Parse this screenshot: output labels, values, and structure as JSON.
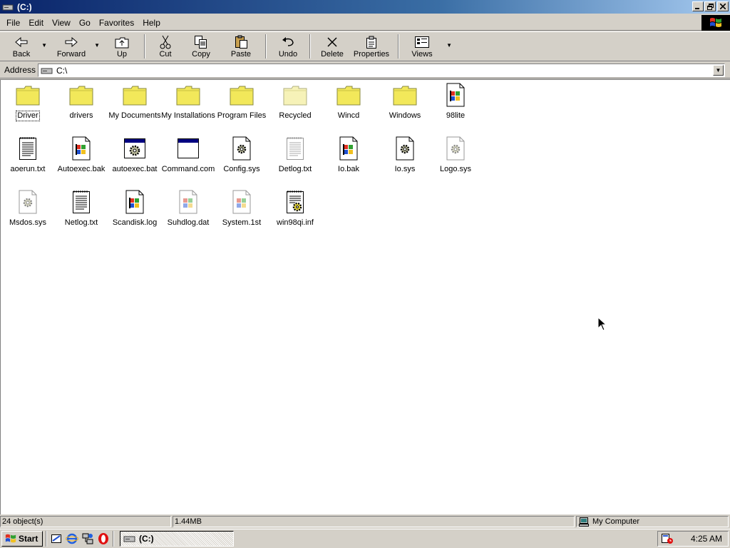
{
  "window": {
    "title": "(C:)"
  },
  "menu": [
    {
      "label": "File",
      "key": "F",
      "rest": "ile"
    },
    {
      "label": "Edit",
      "key": "E",
      "rest": "dit"
    },
    {
      "label": "View",
      "key": "V",
      "rest": "iew"
    },
    {
      "label": "Go",
      "key": "G",
      "rest": "o"
    },
    {
      "label": "Favorites",
      "key": "F",
      "rest": "avorites",
      "pre": ""
    },
    {
      "label": "Help",
      "key": "H",
      "rest": "elp"
    }
  ],
  "toolbar": {
    "back": "Back",
    "forward": "Forward",
    "up": "Up",
    "cut": "Cut",
    "copy": "Copy",
    "paste": "Paste",
    "undo": "Undo",
    "delete": "Delete",
    "properties": "Properties",
    "views": "Views"
  },
  "address": {
    "label": "Address",
    "value": "C:\\"
  },
  "files": [
    {
      "name": "Driver",
      "type": "folder",
      "selected": true
    },
    {
      "name": "drivers",
      "type": "folder"
    },
    {
      "name": "My Documents",
      "type": "folder"
    },
    {
      "name": "My Installations",
      "type": "folder"
    },
    {
      "name": "Program Files",
      "type": "folder"
    },
    {
      "name": "Recycled",
      "type": "folder-light"
    },
    {
      "name": "Wincd",
      "type": "folder"
    },
    {
      "name": "Windows",
      "type": "folder"
    },
    {
      "name": "98lite",
      "type": "win-doc"
    },
    {
      "name": "aoerun.txt",
      "type": "text"
    },
    {
      "name": "Autoexec.bak",
      "type": "win-doc"
    },
    {
      "name": "autoexec.bat",
      "type": "bat"
    },
    {
      "name": "Command.com",
      "type": "app"
    },
    {
      "name": "Config.sys",
      "type": "gear-doc"
    },
    {
      "name": "Detlog.txt",
      "type": "text-light"
    },
    {
      "name": "Io.bak",
      "type": "win-doc"
    },
    {
      "name": "Io.sys",
      "type": "gear-doc"
    },
    {
      "name": "Logo.sys",
      "type": "gear-doc-light"
    },
    {
      "name": "Msdos.sys",
      "type": "gear-doc-light"
    },
    {
      "name": "Netlog.txt",
      "type": "text"
    },
    {
      "name": "Scandisk.log",
      "type": "win-doc"
    },
    {
      "name": "Suhdlog.dat",
      "type": "win-doc-light"
    },
    {
      "name": "System.1st",
      "type": "win-doc-light"
    },
    {
      "name": "win98qi.inf",
      "type": "inf"
    }
  ],
  "status": {
    "objects": "24 object(s)",
    "size": "1.44MB",
    "zone": "My Computer"
  },
  "taskbar": {
    "start": "Start",
    "task": "(C:)",
    "clock": "4:25 AM"
  },
  "colors": {
    "title_active": "#0a246a",
    "face": "#d4d0c8",
    "folder": "#f2e85a"
  }
}
